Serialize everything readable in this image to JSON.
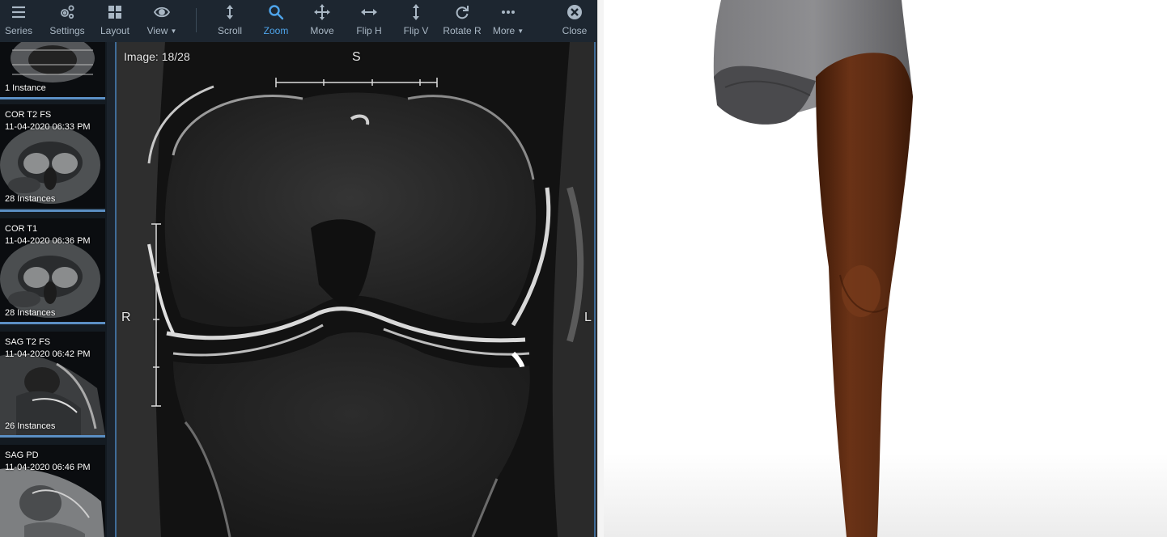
{
  "toolbar": {
    "series": "Series",
    "settings": "Settings",
    "layout": "Layout",
    "view": "View",
    "scroll": "Scroll",
    "zoom": "Zoom",
    "move": "Move",
    "flip_h": "Flip H",
    "flip_v": "Flip V",
    "rotate_r": "Rotate R",
    "more": "More",
    "close": "Close",
    "active_tool": "Zoom",
    "icons": [
      "menu-icon",
      "settings-gears-icon",
      "layout-grid-icon",
      "eye-icon",
      "scroll-arrows-icon",
      "magnifier-icon",
      "move-cross-icon",
      "flip-horizontal-icon",
      "flip-vertical-icon",
      "rotate-icon",
      "more-dots-icon",
      "close-circle-icon"
    ]
  },
  "series_panel": {
    "items": [
      {
        "description": "",
        "date": "",
        "count": "1 Instance",
        "selected": false
      },
      {
        "description": "COR T2 FS",
        "date": "11-04-2020 06:33 PM",
        "count": "28 Instances",
        "selected": true
      },
      {
        "description": "COR T1",
        "date": "11-04-2020 06:36 PM",
        "count": "28 Instances",
        "selected": false
      },
      {
        "description": "SAG T2 FS",
        "date": "11-04-2020 06:42 PM",
        "count": "26 Instances",
        "selected": false
      },
      {
        "description": "SAG PD",
        "date": "11-04-2020 06:46 PM",
        "count": "",
        "selected": false
      }
    ]
  },
  "viewport": {
    "image_index": "Image: 18/28",
    "orientation": {
      "top": "S",
      "left": "R",
      "right": "L"
    }
  },
  "colors": {
    "toolbar_bg": "#1d2630",
    "toolbar_text": "#a9b7c4",
    "active_tool": "#4ea4ea",
    "frame_accent": "#3f6c99",
    "skin": "#5c2a12",
    "shorts": "#6f6f72"
  }
}
